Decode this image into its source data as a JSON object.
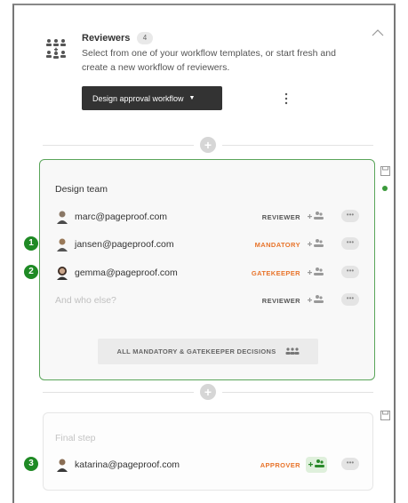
{
  "reviewers": {
    "title": "Reviewers",
    "count": "4",
    "description": "Select from one of your workflow templates, or start fresh and create a new workflow of reviewers."
  },
  "workflow_button": {
    "label": "Design approval workflow"
  },
  "divider_plus": "+",
  "step1": {
    "name": "Design team",
    "rows": [
      {
        "email": "marc@pageproof.com",
        "role": "REVIEWER"
      },
      {
        "email": "jansen@pageproof.com",
        "role": "MANDATORY"
      },
      {
        "email": "gemma@pageproof.com",
        "role": "GATEKEEPER"
      },
      {
        "email": "And who else?",
        "role": "REVIEWER"
      }
    ],
    "decision_button": "ALL MANDATORY & GATEKEEPER DECISIONS"
  },
  "step2": {
    "name": "Final step",
    "rows": [
      {
        "email": "katarina@pageproof.com",
        "role": "APPROVER"
      }
    ]
  },
  "more_label": "•••",
  "callouts": [
    "1",
    "2",
    "3"
  ],
  "colors": {
    "accent_green": "#1f8a25",
    "card_border_green": "#5aa55a",
    "role_orange": "#e8742b",
    "dark_button": "#333333"
  }
}
